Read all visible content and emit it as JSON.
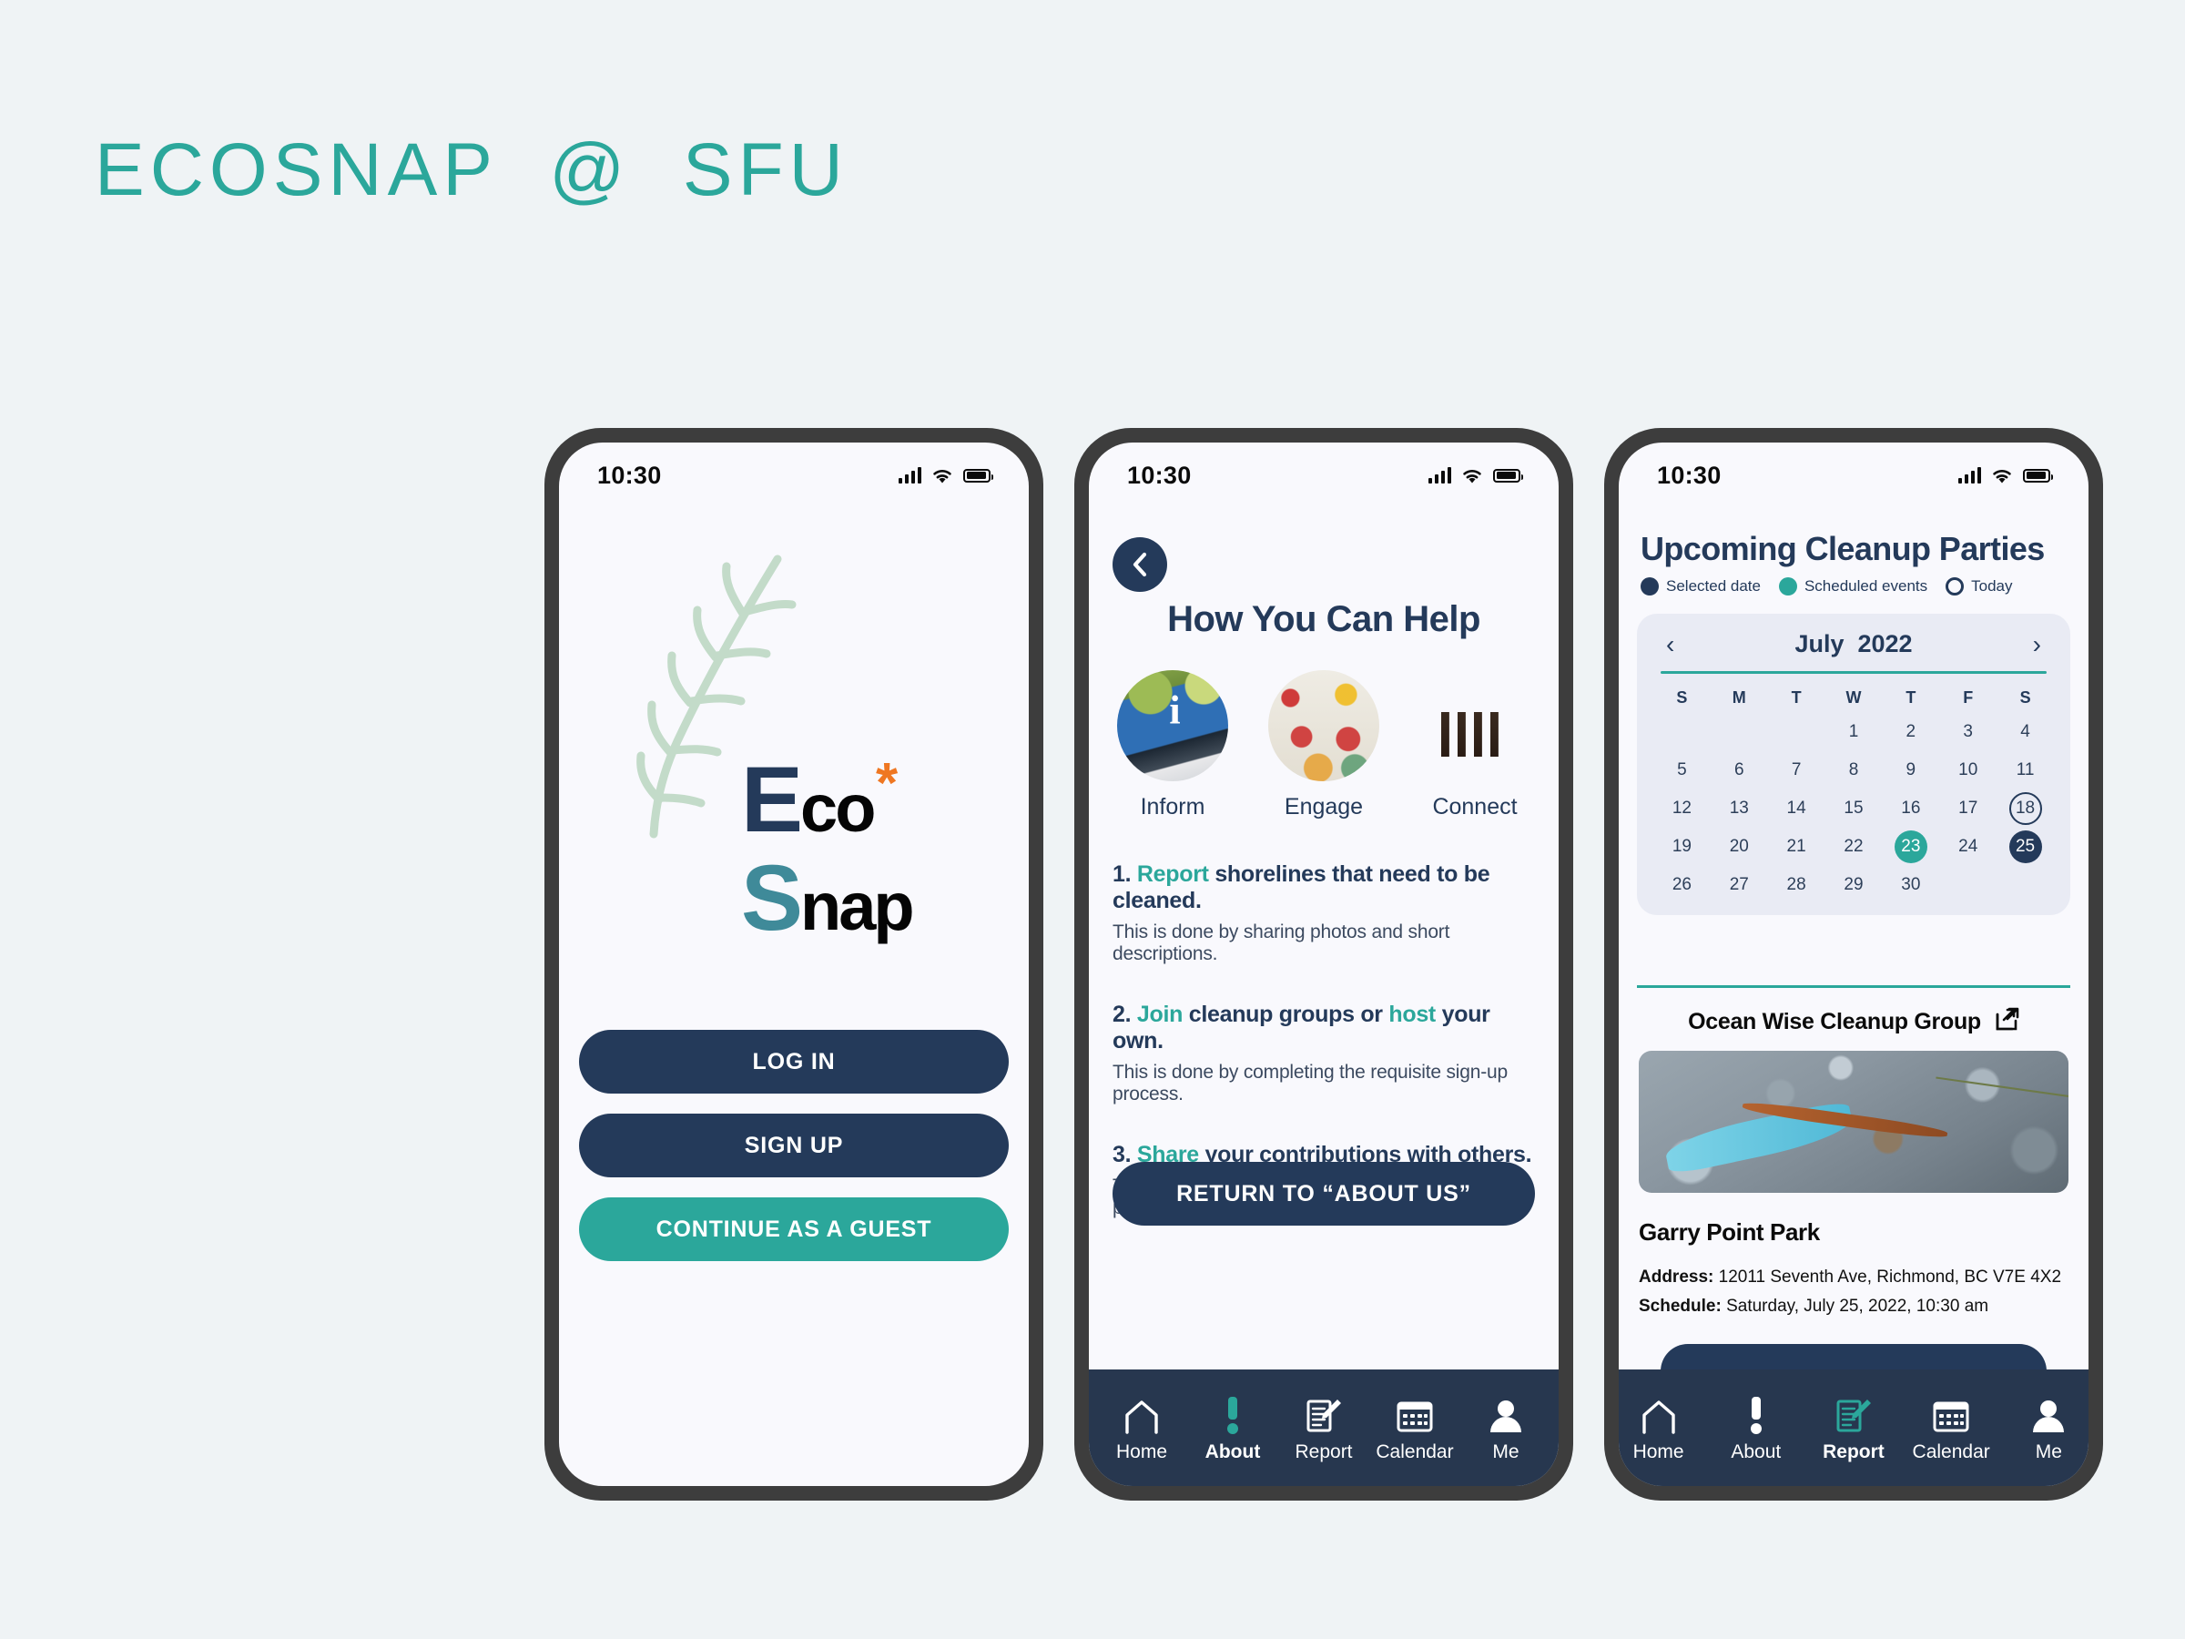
{
  "page": {
    "heading": "ECOSNAP  @  SFU",
    "accent_teal": "#2ba79b",
    "accent_navy": "#243a5a",
    "background": "#eff3f5"
  },
  "screen1": {
    "status": {
      "time": "10:30",
      "signal": "signal-bars-icon",
      "wifi": "wifi-icon",
      "battery": "battery-icon"
    },
    "logo": {
      "e": "E",
      "co": "co",
      "star": "*",
      "s": "S",
      "nap": "nap",
      "branch": "branch-illustration"
    },
    "buttons": {
      "login": "LOG IN",
      "signup": "SIGN UP",
      "guest": "CONTINUE AS A GUEST"
    }
  },
  "screen2": {
    "status": {
      "time": "10:30"
    },
    "back": "back-chevron-icon",
    "title": "How You Can Help",
    "pillars": [
      {
        "label": "Inform",
        "image": "information-sign-photo"
      },
      {
        "label": "Engage",
        "image": "protest-sign-photo"
      },
      {
        "label": "Connect",
        "image": "friends-sunset-photo"
      }
    ],
    "steps": [
      {
        "num": "1. ",
        "highlight": "Report",
        "rest": " shorelines that need to be cleaned.",
        "sub": "This is done by sharing photos and short descriptions."
      },
      {
        "num": "2. ",
        "highlight": "Join",
        "rest": " cleanup groups or ",
        "highlight2": "host",
        "rest2": " your own.",
        "sub": "This is done by completing the requisite sign-up process."
      },
      {
        "num": "3. ",
        "highlight": "Share",
        "rest": " your contributions with others.",
        "sub": "This is done by completing the requisite sign-up process."
      }
    ],
    "return_button": "RETURN TO “ABOUT US”",
    "nav": [
      {
        "label": "Home",
        "icon": "home-icon",
        "active": false
      },
      {
        "label": "About",
        "icon": "exclamation-icon",
        "active": true
      },
      {
        "label": "Report",
        "icon": "report-pencil-icon",
        "active": false
      },
      {
        "label": "Calendar",
        "icon": "calendar-icon",
        "active": false
      },
      {
        "label": "Me",
        "icon": "person-icon",
        "active": false
      }
    ]
  },
  "screen3": {
    "status": {
      "time": "10:30"
    },
    "title": "Upcoming Cleanup Parties",
    "legend": [
      {
        "label": "Selected date",
        "style": "navy"
      },
      {
        "label": "Scheduled events",
        "style": "teal"
      },
      {
        "label": "Today",
        "style": "ring"
      }
    ],
    "calendar": {
      "month": "July  2022",
      "prev": "‹",
      "next": "›",
      "dow": [
        "S",
        "M",
        "T",
        "W",
        "T",
        "F",
        "S"
      ],
      "leading_blanks": 3,
      "days": [
        1,
        2,
        3,
        4,
        5,
        6,
        7,
        8,
        9,
        10,
        11,
        12,
        13,
        14,
        15,
        16,
        17,
        18,
        19,
        20,
        21,
        22,
        23,
        24,
        25,
        26,
        27,
        28,
        29,
        30
      ],
      "today": 18,
      "event_days": [
        23
      ],
      "selected": 25
    },
    "event": {
      "group": "Ocean Wise Cleanup Group",
      "external_icon": "external-link-icon",
      "photo": "shoreline-debris-photo",
      "park": "Garry Point Park",
      "address_label": "Address:",
      "address_value": " 12011 Seventh Ave, Richmond, BC V7E 4X2",
      "schedule_label": "Schedule:",
      "schedule_value": " Saturday, July 25, 2022, 10:30 am"
    },
    "nav": [
      {
        "label": "Home",
        "icon": "home-icon",
        "active": false
      },
      {
        "label": "About",
        "icon": "exclamation-icon",
        "active": false
      },
      {
        "label": "Report",
        "icon": "report-pencil-icon",
        "active": true
      },
      {
        "label": "Calendar",
        "icon": "calendar-icon",
        "active": false
      },
      {
        "label": "Me",
        "icon": "person-icon",
        "active": false
      }
    ]
  }
}
